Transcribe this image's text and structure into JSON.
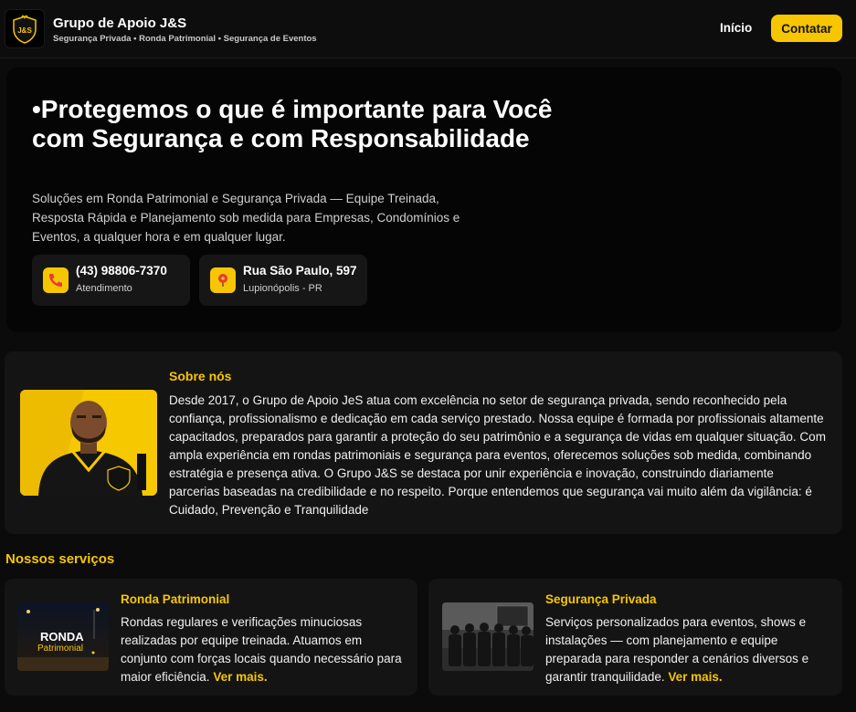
{
  "header": {
    "brand_title": "Grupo de Apoio J&S",
    "brand_subtitle": "Segurança Privada • Ronda Patrimonial • Segurança de Eventos",
    "logo_text": "J&S",
    "nav_inicio": "Início",
    "contact_button": "Contatar"
  },
  "hero": {
    "title": "•Protegemos o que é importante para Você com Segurança e com Responsabilidade",
    "description": "Soluções em Ronda Patrimonial e Segurança Privada — Equipe Treinada, Resposta Rápida e Planejamento sob medida para Empresas, Condomínios e Eventos, a qualquer hora e em qualquer lugar.",
    "phone": {
      "icon": "phone-icon",
      "value": "(43) 98806-7370",
      "label": "Atendimento"
    },
    "address": {
      "icon": "map-pin-icon",
      "value": "Rua São Paulo, 597",
      "label": "Lupionópolis - PR"
    }
  },
  "about": {
    "title": "Sobre nós",
    "text": "Desde 2017, o Grupo de Apoio JeS atua com excelência no setor de segurança privada, sendo reconhecido pela confiança, profissionalismo e dedicação em cada serviço prestado. Nossa equipe é formada por profissionais altamente capacitados, preparados para garantir a proteção do seu patrimônio e a segurança de vidas em qualquer situação. Com ampla experiência em rondas patrimoniais e segurança para eventos, oferecemos soluções sob medida, combinando estratégia e presença ativa. O Grupo J&S se destaca por unir experiência e inovação, construindo diariamente parcerias baseadas na credibilidade e no respeito. Porque entendemos que segurança vai muito além da vigilância: é Cuidado, Prevenção e Tranquilidade"
  },
  "services": {
    "title": "Nossos serviços",
    "items": [
      {
        "title": "Ronda Patrimonial",
        "text": "Rondas regulares e verificações minuciosas realizadas por equipe treinada. Atuamos em conjunto com forças locais quando necessário para maior eficiência.",
        "link": "Ver mais.",
        "image_text_1": "RONDA",
        "image_text_2": "Patrimonial"
      },
      {
        "title": "Segurança Privada",
        "text": "Serviços personalizados para eventos, shows e instalações — com planejamento e equipe preparada para responder a cenários diversos e garantir tranquilidade.",
        "link": "Ver mais."
      }
    ]
  },
  "colors": {
    "accent": "#f7c600",
    "background": "#0b0b0b",
    "card": "#141414"
  }
}
